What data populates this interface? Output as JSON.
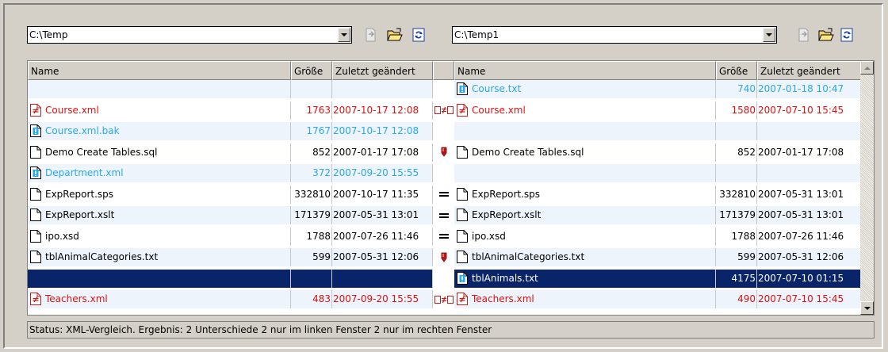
{
  "left": {
    "path": "C:\\Temp"
  },
  "right": {
    "path": "C:\\Temp1"
  },
  "columns": {
    "left": {
      "name": "Name",
      "size": "Größe",
      "date": "Zuletzt geändert"
    },
    "right": {
      "name": "Name",
      "size": "Größe",
      "date": "Zuletzt geändert"
    }
  },
  "rows": [
    {
      "left": null,
      "status": "",
      "right": {
        "name": "Course.txt",
        "size": "740",
        "date": "2007-01-18 10:47",
        "color": "blue",
        "icon": "exclamation-file-icon"
      }
    },
    {
      "left": {
        "name": "Course.xml",
        "size": "1763",
        "date": "2007-10-17 12:08",
        "color": "red",
        "icon": "not-equal-file-icon"
      },
      "status": "different",
      "right": {
        "name": "Course.xml",
        "size": "1580",
        "date": "2007-07-10 15:45",
        "color": "red",
        "icon": "not-equal-file-icon"
      }
    },
    {
      "left": {
        "name": "Course.xml.bak",
        "size": "1767",
        "date": "2007-10-17 12:08",
        "color": "blue",
        "icon": "exclamation-file-icon"
      },
      "status": "",
      "right": null
    },
    {
      "left": {
        "name": "Demo Create Tables.sql",
        "size": "852",
        "date": "2007-01-17 17:08",
        "color": "black",
        "icon": "file-icon"
      },
      "status": "unknown",
      "right": {
        "name": "Demo Create Tables.sql",
        "size": "852",
        "date": "2007-01-17 17:08",
        "color": "black",
        "icon": "file-icon"
      }
    },
    {
      "left": {
        "name": "Department.xml",
        "size": "372",
        "date": "2007-09-20 15:55",
        "color": "blue",
        "icon": "exclamation-file-icon"
      },
      "status": "",
      "right": null
    },
    {
      "left": {
        "name": "ExpReport.sps",
        "size": "332810",
        "date": "2007-10-17 11:35",
        "color": "black",
        "icon": "file-icon"
      },
      "status": "equal",
      "right": {
        "name": "ExpReport.sps",
        "size": "332810",
        "date": "2007-05-31 13:01",
        "color": "black",
        "icon": "file-icon"
      }
    },
    {
      "left": {
        "name": "ExpReport.xslt",
        "size": "171379",
        "date": "2007-05-31 13:01",
        "color": "black",
        "icon": "file-icon"
      },
      "status": "equal",
      "right": {
        "name": "ExpReport.xslt",
        "size": "171379",
        "date": "2007-05-31 13:01",
        "color": "black",
        "icon": "file-icon"
      }
    },
    {
      "left": {
        "name": "ipo.xsd",
        "size": "1788",
        "date": "2007-07-26 11:46",
        "color": "black",
        "icon": "file-icon"
      },
      "status": "equal",
      "right": {
        "name": "ipo.xsd",
        "size": "1788",
        "date": "2007-07-26 11:46",
        "color": "black",
        "icon": "file-icon"
      }
    },
    {
      "left": {
        "name": "tblAnimalCategories.txt",
        "size": "599",
        "date": "2007-05-31 12:06",
        "color": "black",
        "icon": "file-icon"
      },
      "status": "unknown",
      "right": {
        "name": "tblAnimalCategories.txt",
        "size": "599",
        "date": "2007-05-31 12:06",
        "color": "black",
        "icon": "file-icon"
      }
    },
    {
      "left": null,
      "status": "",
      "selected": true,
      "right": {
        "name": "tblAnimals.txt",
        "size": "4175",
        "date": "2007-07-10 01:15",
        "color": "blue",
        "icon": "exclamation-file-icon"
      }
    },
    {
      "left": {
        "name": "Teachers.xml",
        "size": "483",
        "date": "2007-09-20 15:55",
        "color": "red",
        "icon": "not-equal-file-icon"
      },
      "status": "different",
      "right": {
        "name": "Teachers.xml",
        "size": "490",
        "date": "2007-07-10 15:45",
        "color": "red",
        "icon": "not-equal-file-icon"
      }
    }
  ],
  "status_bar": {
    "text": "Status: XML-Vergleich. Ergebnis: 2 Unterschiede 2 nur im linken Fenster 2 nur im rechten Fenster"
  },
  "colors": {
    "selection": "#0a246a",
    "different": "#e01010",
    "only_one_side": "#2aa8e8",
    "alt_row": "#edf4fb"
  }
}
